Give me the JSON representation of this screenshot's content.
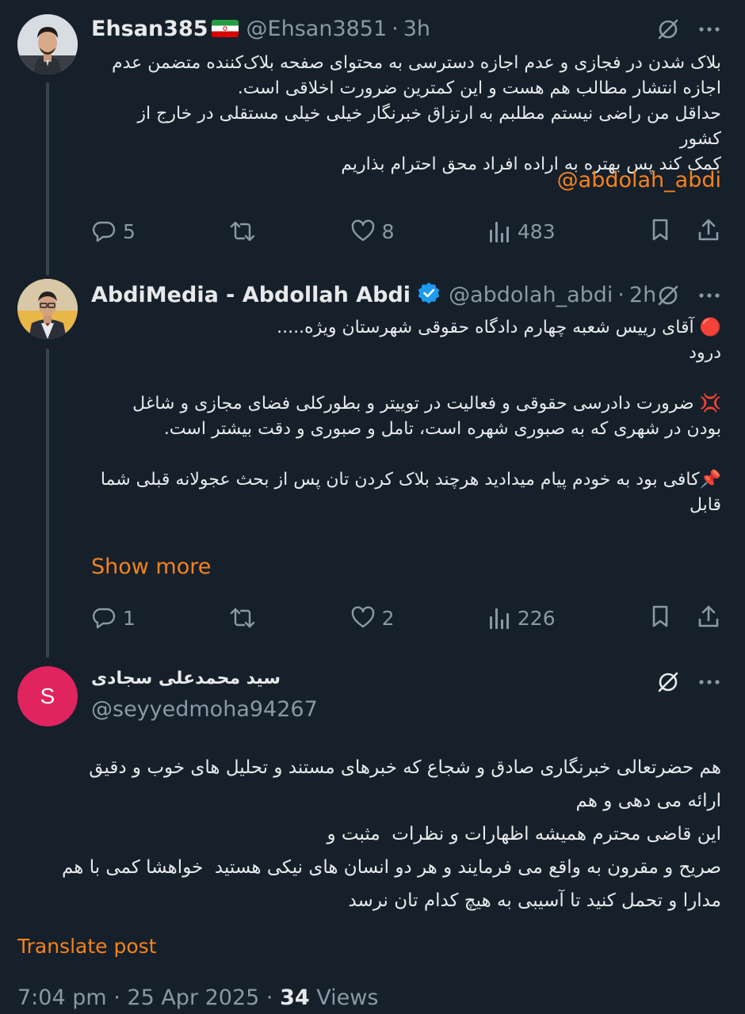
{
  "tweet1": {
    "name": "Ehsan385",
    "flag": "🇮🇷",
    "handle": "@Ehsan3851",
    "time": "3h",
    "text": "بلاک شدن در فجازی و عدم اجازه دسترسی به محتوای صفحه بلاک‌کننده متضمن عدم\nاجازه انتشار مطالب هم هست و این کمترین ضرورت اخلاقی است.\nحداقل من راضی نیستم مطلبم به ارتزاق خبرنگار خیلی خیلی مستقلی در خارج از کشور\nکمک کند پس بهتره به اراده افراد محق احترام بذاریم",
    "mention": "@abdolah_abdi",
    "replies": "5",
    "likes": "8",
    "views": "483"
  },
  "tweet2": {
    "name": "AbdiMedia - Abdollah Abdi",
    "handle": "@abdolah_abdi",
    "time": "2h",
    "text": "🔴 آقای رییس شعبه چهارم دادگاه حقوقی شهرستان ویژه.....\nدرود\n\n💢 ضرورت دادرسی حقوقی و فعالیت در توییتر و بطورکلی فضای مجازی و شاغل\nبودن در شهری که به صبوری شهره است، تامل و صبوری و دقت بیشتر است.\n\n📌کافی بود به خودم پیام میدادید هرچند بلاک کردن تان پس از بحث عجولانه قبلی شما\nقابل",
    "show_more": "Show more",
    "replies": "1",
    "likes": "2",
    "views": "226"
  },
  "tweet3": {
    "avatar_letter": "S",
    "avatar_color": "#e0245e",
    "name": "سید محمدعلی سجادی",
    "handle": "@seyyedmoha94267",
    "text": "هم حضرتعالی خبرنگاری صادق و شجاع که خبرهای مستند و تحلیل های خوب و دقیق\nارائه می دهی و هم\nاین قاضی محترم همیشه اظهارات و نظرات  مثبت و\nصریح و مقرون به واقع می فرمایند و هر دو انسان های نیکی هستید  خواهشا کمی با هم\nمدارا و تحمل کنید تا آسیبی به هیچ کدام تان نرسد",
    "translate": "Translate post",
    "footer_time": "7:04 pm · 25 Apr 2025 · ",
    "views_count": "34",
    "views_label": " Views"
  },
  "icons": {
    "grok": "grok-icon",
    "more": "more-icon",
    "reply": "reply-icon",
    "retweet": "retweet-icon",
    "like": "like-icon",
    "views": "views-icon",
    "bookmark": "bookmark-icon",
    "share": "share-icon",
    "verified": "verified-icon"
  },
  "colors": {
    "background": "#15202b",
    "accent": "#f7821b",
    "secondary_text": "#8b98a5",
    "verified": "#1d9bf0"
  }
}
